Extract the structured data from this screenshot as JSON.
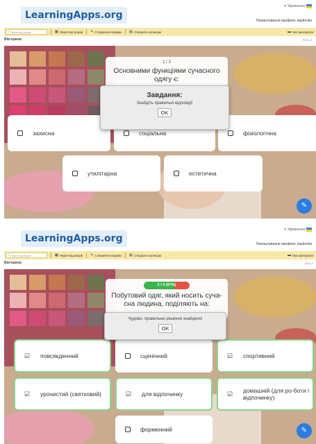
{
  "header": {
    "logo": "LearningApps.org",
    "language": "Українська",
    "profile": "Налаштування профілю: paykovka"
  },
  "nav": {
    "search_placeholder": "Перегляд вправ",
    "browse": "Перегляд вправ",
    "create": "Створення вправи",
    "collections": "Створити колекцію",
    "my_materials": "Мої матеріали"
  },
  "app_title": "Вікторина",
  "date_fragment_1": "2023-11-",
  "date_fragment_2": "2023-1",
  "shot1": {
    "question_counter": "1 / 3",
    "question": "Основними функціями сучасного одягу є:",
    "dialog": {
      "title": "Завдання:",
      "message": "Знайдіть правильні відповіді!",
      "ok": "OK"
    },
    "answers": [
      {
        "label": "захисна"
      },
      {
        "label": "соціальна"
      },
      {
        "label": "фізіологічна"
      },
      {
        "label": "утилітарна"
      },
      {
        "label": "естетична"
      }
    ]
  },
  "shot2": {
    "progress": "2 / 3 (67%)",
    "progress_percent": 67,
    "question": "Побутовий одяг, який носить суча-сна людина, поділяють на:",
    "dialog": {
      "message": "Чудово, правильне рішення знайдено!",
      "ok": "OK"
    },
    "answers": [
      {
        "label": "повсякденний",
        "selected": true
      },
      {
        "label": "сценічний",
        "selected": false
      },
      {
        "label": "спортивний",
        "selected": true
      },
      {
        "label": "урочистий (святковий)",
        "selected": true
      },
      {
        "label": "для відпочинку",
        "selected": true
      },
      {
        "label": "домашній (для ро-боти і відпочинку)",
        "selected": true
      },
      {
        "label": "форменний",
        "selected": false
      }
    ]
  },
  "colors": {
    "logo_blue": "#1d5f9f",
    "nav_bg": "#f7e8a8",
    "correct_border": "#8bd28b",
    "fab_blue": "#2a7de1",
    "progress_green": "#3bb44a",
    "progress_red": "#e25444"
  },
  "icons": {
    "checkbox_empty": "square-outline",
    "checkbox_checked": "check-square",
    "fab": "edit-square-icon"
  }
}
